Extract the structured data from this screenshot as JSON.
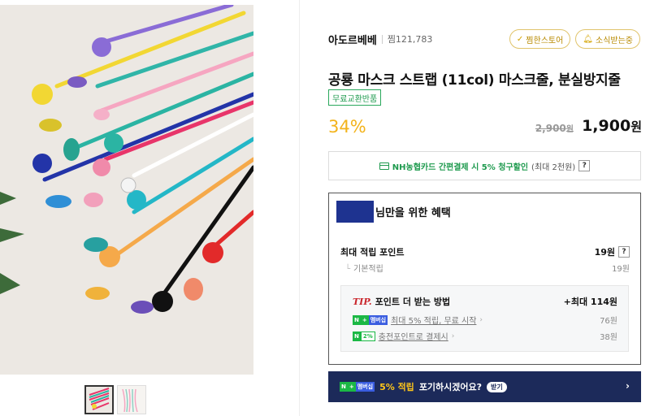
{
  "store": {
    "name": "아도르베베",
    "zzim": "찜121,783",
    "btn_pick": "찜한스토어",
    "btn_news": "소식받는중"
  },
  "product": {
    "title": "공룡 마스크 스트랩 (11col) 마스크줄, 분실방지줄",
    "badge": "무료교환반품",
    "discount": "34%",
    "original_price": "2,900",
    "original_unit": "원",
    "sale_price": "1,900",
    "sale_unit": "원"
  },
  "card_promo": {
    "green": "NH농협카드 간편결제 시 5% 청구할인",
    "grey": "(최대 2천원)",
    "help": "?"
  },
  "benefit": {
    "title": "님만을 위한 혜택",
    "max_point_label": "최대 적립 포인트",
    "max_point_value": "19원",
    "help": "?",
    "basic_label": "기본적립",
    "basic_value": "19원",
    "tip": {
      "em": "TIP.",
      "head": "포인트 더 받는 방법",
      "total": "+최대 114원",
      "line1_badge_n": "N",
      "line1_badge_plus": "+",
      "line1_badge_m": "멤버십",
      "line1_text": "최대 5% 적립, 무료 시작",
      "line1_value": "76원",
      "line2_badge_n": "N",
      "line2_badge_p": "2%",
      "line2_text": "충전포인트로 결제시",
      "line2_value": "38원"
    }
  },
  "banner": {
    "badge_n": "N",
    "badge_plus": "+",
    "badge_m": "멤버십",
    "highlight": "5% 적립",
    "text": "포기하시겠어요?",
    "get": "받기"
  }
}
